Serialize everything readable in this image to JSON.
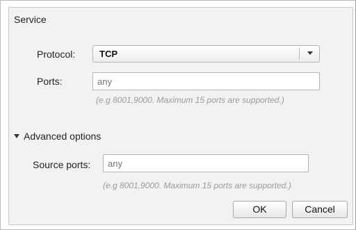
{
  "section": {
    "title": "Service"
  },
  "protocol": {
    "label": "Protocol:",
    "value": "TCP"
  },
  "ports": {
    "label": "Ports:",
    "placeholder": "any",
    "hint": "(e.g 8001,9000. Maximum 15 ports are supported.)"
  },
  "advanced": {
    "toggle_label": "Advanced options",
    "expanded": true,
    "source_ports": {
      "label": "Source ports:",
      "placeholder": "any",
      "hint": "(e.g 8001,9000. Maximum 15 ports are supported.)"
    }
  },
  "buttons": {
    "ok": "OK",
    "cancel": "Cancel"
  },
  "icons": {
    "select_arrow": "chevron-down-icon",
    "advanced_arrow": "caret-down-icon"
  }
}
